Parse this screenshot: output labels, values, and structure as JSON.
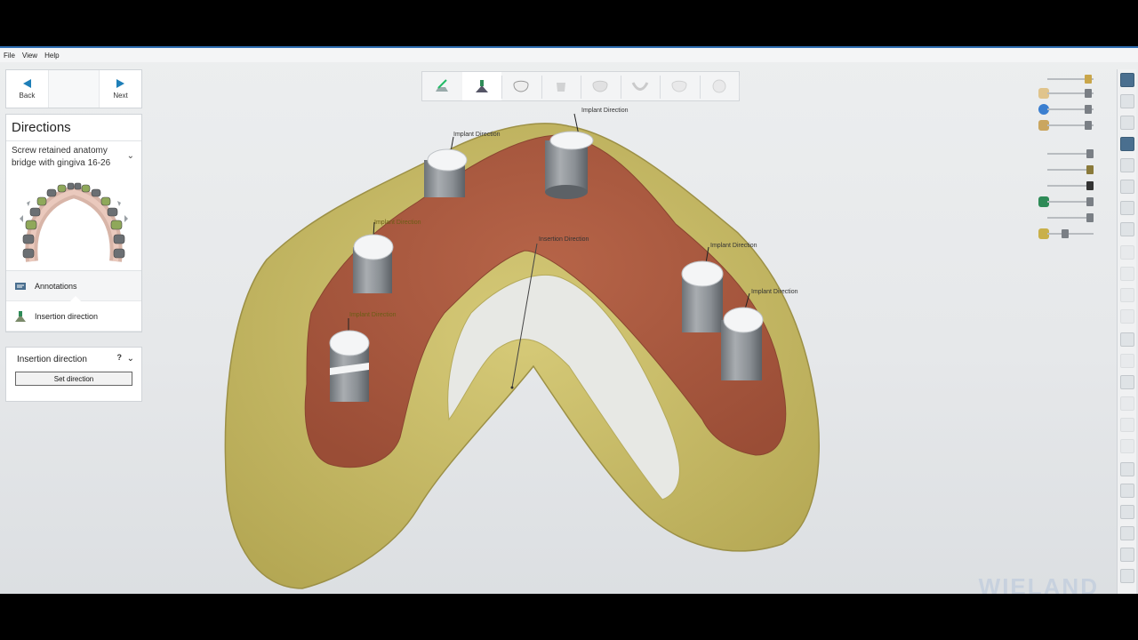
{
  "menu": {
    "items": [
      "File",
      "View",
      "Help"
    ]
  },
  "nav": {
    "back_label": "Back",
    "next_label": "Next"
  },
  "panel": {
    "title": "Directions",
    "case_line1": "Screw retained anatomy",
    "case_line2": "bridge with gingiva 16-26",
    "tools": [
      {
        "label": "Annotations",
        "icon": "annotations-icon"
      },
      {
        "label": "Insertion direction",
        "icon": "insertion-direction-icon"
      }
    ]
  },
  "subpanel": {
    "title": "Insertion direction",
    "help": "?",
    "button": "Set direction"
  },
  "toolbar": {
    "steps": [
      "scan-step-icon",
      "directions-step-icon",
      "crown-step-icon",
      "abutment-step-icon",
      "framework-step-icon",
      "gingiva-step-icon",
      "cutback-step-icon",
      "finish-step-icon"
    ],
    "active_index": 1
  },
  "viewport": {
    "labels": {
      "implant1": "Implant Direction",
      "implant2": "Implant Direction",
      "implant3": "Implant Direction",
      "implant4": "Implant Direction",
      "implant5": "Implant Direction",
      "implant6": "Implant Direction",
      "insertion": "Insertion Direction"
    }
  },
  "colors": {
    "gingiva": "#a8583f",
    "model": "#c9bd6a",
    "cylinder": "#8e9398",
    "accent": "#1e7fb8"
  },
  "watermark": "WIELAND"
}
